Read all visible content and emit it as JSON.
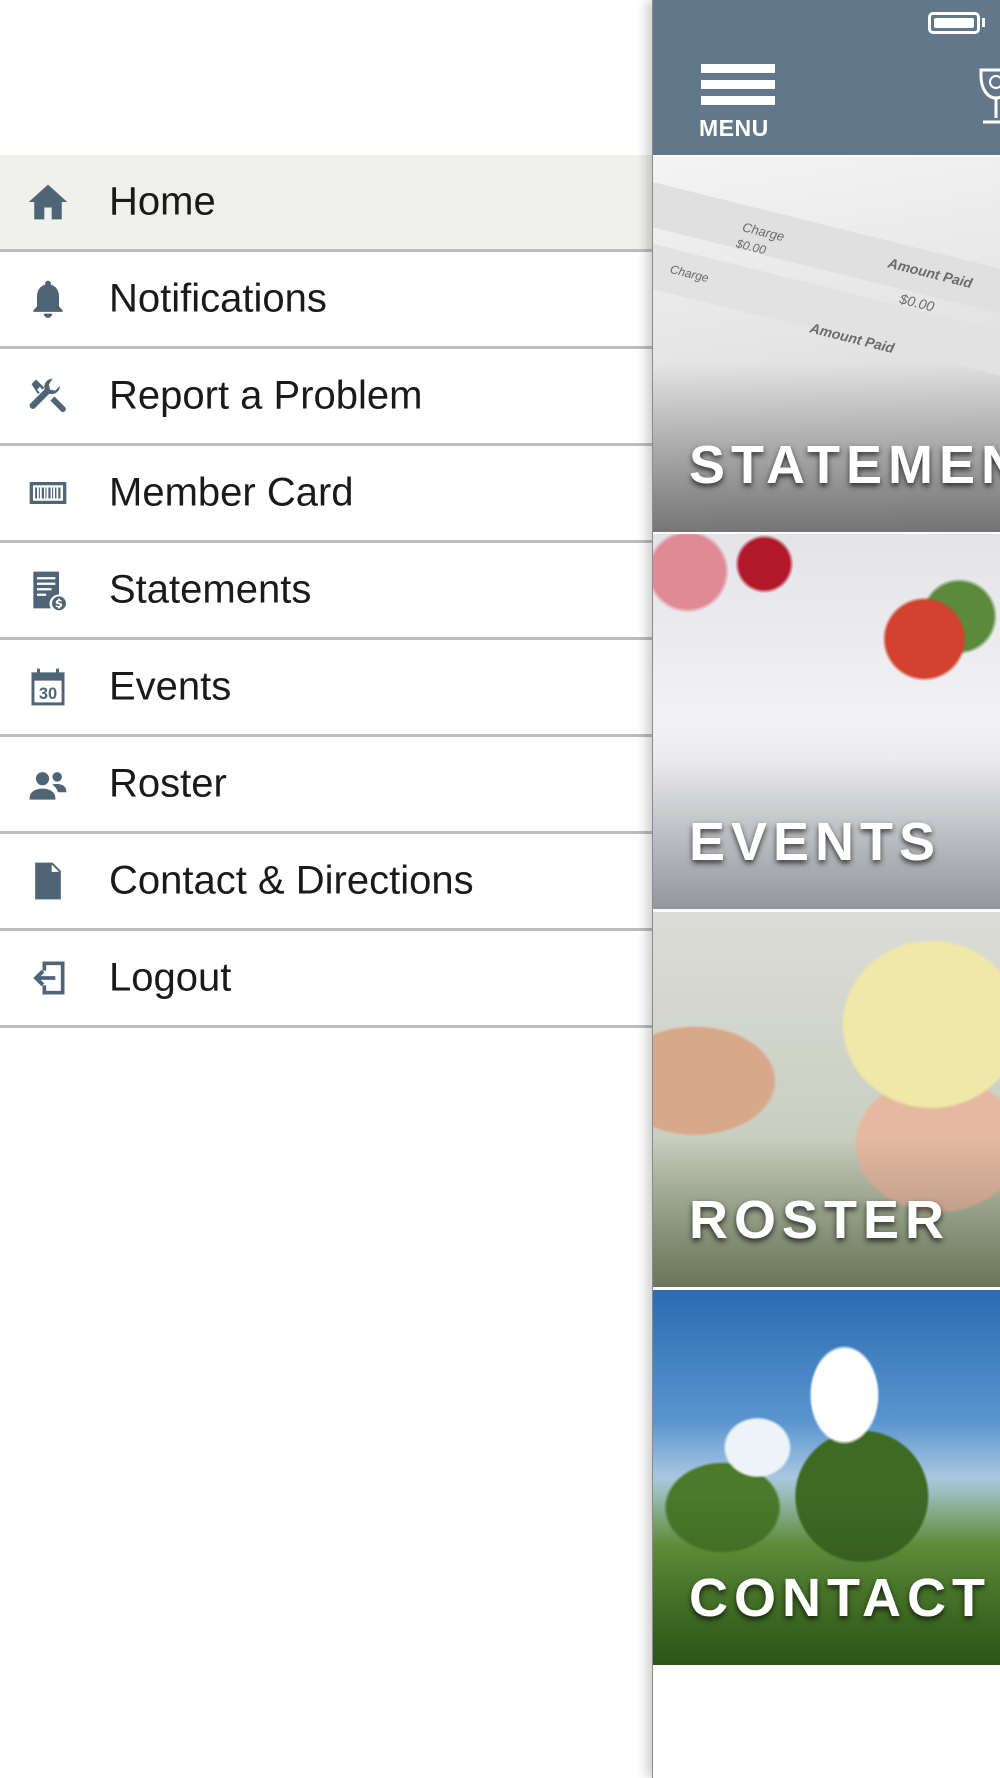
{
  "drawer": {
    "items": [
      {
        "label": "Home",
        "icon": "home-icon",
        "active": true
      },
      {
        "label": "Notifications",
        "icon": "bell-icon",
        "active": false
      },
      {
        "label": "Report a Problem",
        "icon": "tools-icon",
        "active": false
      },
      {
        "label": "Member Card",
        "icon": "barcode-card-icon",
        "active": false
      },
      {
        "label": "Statements",
        "icon": "statement-icon",
        "active": false
      },
      {
        "label": "Events",
        "icon": "calendar-icon",
        "active": false
      },
      {
        "label": "Roster",
        "icon": "people-icon",
        "active": false
      },
      {
        "label": "Contact & Directions",
        "icon": "document-icon",
        "active": false
      },
      {
        "label": "Logout",
        "icon": "logout-icon",
        "active": false
      }
    ],
    "calendar_day": "30"
  },
  "header": {
    "menu_label": "MENU",
    "accent_color": "#627789"
  },
  "tiles": [
    {
      "label": "STATEMEN"
    },
    {
      "label": "EVENTS"
    },
    {
      "label": "ROSTER"
    },
    {
      "label": "CONTACT &"
    }
  ],
  "statements_tile": {
    "col_change": "Charge",
    "col_paid": "Amount Paid",
    "val_change": "$0.00",
    "val_paid": "$0.00"
  },
  "colors": {
    "icon": "#4f6577",
    "active_row": "#f0f0ec",
    "divider": "#bdbdbd"
  }
}
